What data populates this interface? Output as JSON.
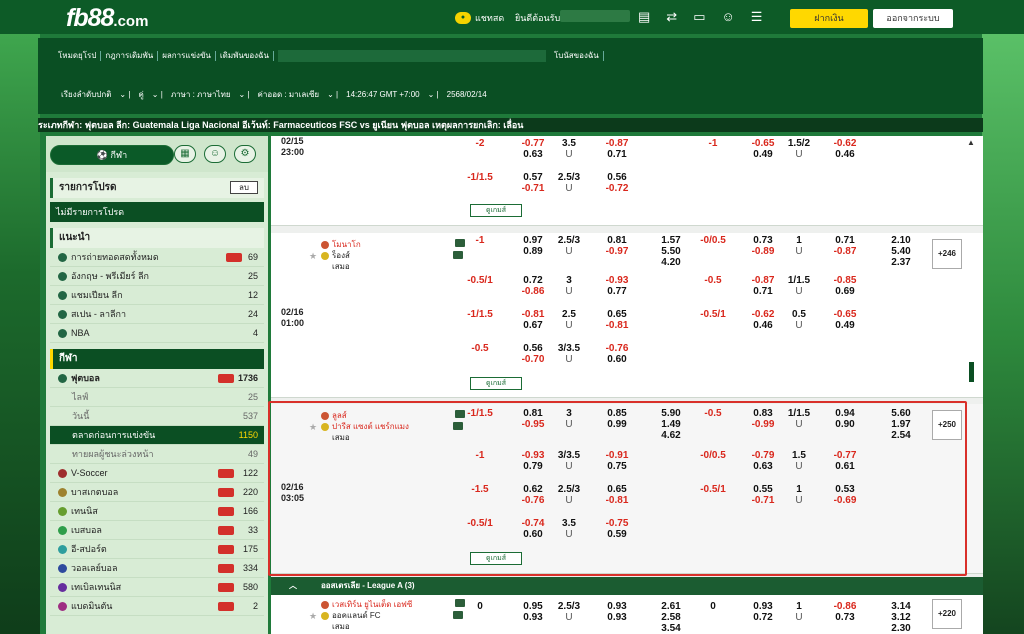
{
  "header": {
    "logo": "fb88",
    "logo_suffix": ".com",
    "chat": "แชทสด",
    "welcome": "ยินดีต้อนรับ",
    "deposit": "ฝากเงิน",
    "logout": "ออกจากระบบ"
  },
  "nav": {
    "links": [
      "โหมดยุโรป",
      "กฎการเดิมพัน",
      "ผลการแข่งขัน",
      "เดิมพันของฉัน",
      "โบนัสของฉัน"
    ],
    "settings": [
      "เรียงลำดับปกติ",
      "คู่",
      "ภาษา : ภาษาไทย",
      "ค่าออด : มาเลเซีย",
      "14:26:47 GMT +7:00",
      "2568/02/14"
    ]
  },
  "ticker": "ระเภทกีฬา: ฟุตบอล ลีก: Guatemala Liga Nacional อีเว้นท์: Farmaceuticos FSC vs ยูเนียน ฟุตบอล เหตุผลการยกเลิก: เลื่อน",
  "sidebar": {
    "sport_pill": "กีฬา",
    "mybets_title": "รายการโปรด",
    "mybets_btn": "ลบ",
    "mybets_empty": "ไม่มีรายการโปรด",
    "rec_title": "แนะนำ",
    "rec": [
      {
        "label": "การถ่ายทอดสดทั้งหมด",
        "count": "69"
      },
      {
        "label": "อังกฤษ - พรีเมียร์ ลีก",
        "count": "25"
      },
      {
        "label": "แชมเปียน ลีก",
        "count": "12"
      },
      {
        "label": "สเปน - ลาลีกา",
        "count": "24"
      },
      {
        "label": "NBA",
        "count": "4"
      }
    ],
    "sport_title": "กีฬา",
    "soccer": {
      "label": "ฟุตบอล",
      "count": "1736"
    },
    "soccer_sub": [
      {
        "label": "ไลฟ์",
        "count": "25"
      },
      {
        "label": "วันนี้",
        "count": "537"
      },
      {
        "label": "ตลาดก่อนการแข่งขัน",
        "count": "1150"
      },
      {
        "label": "ทายผลผู้ชนะล่วงหน้า",
        "count": "49"
      }
    ],
    "sports": [
      {
        "label": "V-Soccer",
        "count": "122"
      },
      {
        "label": "บาสเกตบอล",
        "count": "220"
      },
      {
        "label": "เทนนิส",
        "count": "166"
      },
      {
        "label": "เบสบอล",
        "count": "33"
      },
      {
        "label": "อี-สปอร์ต",
        "count": "175"
      },
      {
        "label": "วอลเลย์บอล",
        "count": "334"
      },
      {
        "label": "เทเบิลเทนนิส",
        "count": "580"
      },
      {
        "label": "แบดมินตัน",
        "count": "2"
      }
    ]
  },
  "more_label": "ดูเกมส์",
  "m0": {
    "time1": "02/15",
    "time2": "23:00",
    "r1": [
      "-2",
      "-0.77",
      "0.63",
      "3.5",
      "U",
      "-0.87",
      "0.71",
      "-1",
      "-0.65",
      "0.49",
      "1.5/2",
      "U",
      "-0.62",
      "0.46"
    ],
    "r2": [
      "-1/1.5",
      "0.57",
      "-0.71",
      "2.5/3",
      "U",
      "0.56",
      "-0.72"
    ]
  },
  "m1": {
    "time1": "02/16",
    "time2": "01:00",
    "home": "โมนาโก",
    "away": "ร็องส์",
    "draw": "เสมอ",
    "plus": "+246",
    "r1": [
      "-1",
      "0.97",
      "0.89",
      "2.5/3",
      "U",
      "0.81",
      "-0.97",
      "1.57",
      "5.50",
      "4.20",
      "-0/0.5",
      "0.73",
      "-0.89",
      "1",
      "U",
      "0.71",
      "-0.87",
      "2.10",
      "5.40",
      "2.37"
    ],
    "r2": [
      "-0.5/1",
      "0.72",
      "-0.86",
      "3",
      "U",
      "-0.93",
      "0.77",
      "-0.5",
      "-0.87",
      "0.71",
      "1/1.5",
      "U",
      "-0.85",
      "0.69"
    ],
    "r3": [
      "-1/1.5",
      "-0.81",
      "0.67",
      "2.5",
      "U",
      "0.65",
      "-0.81",
      "-0.5/1",
      "-0.62",
      "0.46",
      "0.5",
      "U",
      "-0.65",
      "0.49"
    ],
    "r4": [
      "-0.5",
      "0.56",
      "-0.70",
      "3/3.5",
      "U",
      "-0.76",
      "0.60"
    ]
  },
  "m2": {
    "time1": "02/16",
    "time2": "03:05",
    "home": "ลูลส์",
    "away": "ปารีส แซงต์ แชร์กแมง",
    "draw": "เสมอ",
    "plus": "+250",
    "r1": [
      "-1/1.5",
      "0.81",
      "-0.95",
      "3",
      "U",
      "0.85",
      "0.99",
      "5.90",
      "1.49",
      "4.62",
      "-0.5",
      "0.83",
      "-0.99",
      "1/1.5",
      "U",
      "0.94",
      "0.90",
      "5.60",
      "1.97",
      "2.54"
    ],
    "r2": [
      "-1",
      "-0.93",
      "0.79",
      "3/3.5",
      "U",
      "-0.91",
      "0.75",
      "-0/0.5",
      "-0.79",
      "0.63",
      "1.5",
      "U",
      "-0.77",
      "0.61"
    ],
    "r3": [
      "-1.5",
      "0.62",
      "-0.76",
      "2.5/3",
      "U",
      "0.65",
      "-0.81",
      "-0.5/1",
      "0.55",
      "-0.71",
      "1",
      "U",
      "0.53",
      "-0.69"
    ],
    "r4": [
      "-0.5/1",
      "-0.74",
      "0.60",
      "3.5",
      "U",
      "-0.75",
      "0.59"
    ]
  },
  "league": "ออสเตรเลีย - League A (3)",
  "m3": {
    "home": "เวสเทิร์น ยูไนเต็ด เอฟซี",
    "away": "ออคแลนด์ FC",
    "draw": "เสมอ",
    "plus": "+220",
    "r1": [
      "0",
      "0.95",
      "0.93",
      "2.5/3",
      "U",
      "0.93",
      "0.93",
      "2.61",
      "2.58",
      "3.54",
      "0",
      "0.93",
      "0.72",
      "1",
      "U",
      "-0.86",
      "0.73",
      "3.14",
      "3.12",
      "2.30"
    ]
  }
}
